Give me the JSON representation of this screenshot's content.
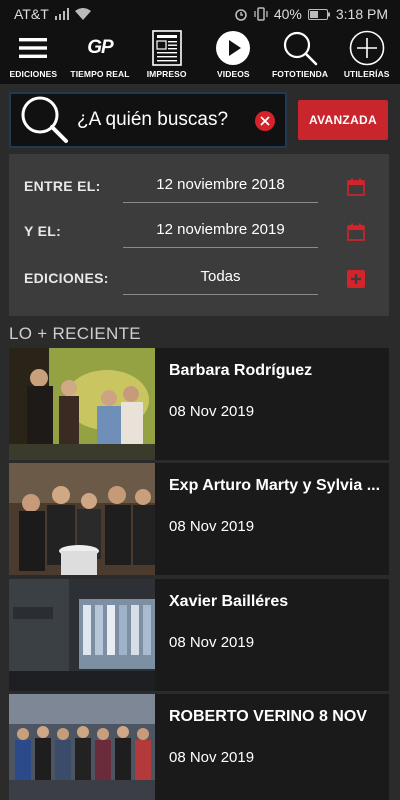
{
  "status": {
    "carrier": "AT&T",
    "battery": "40%",
    "time": "3:18 PM"
  },
  "nav": [
    {
      "label": "EDICIONES",
      "icon": "hamburger-menu-icon"
    },
    {
      "label": "TIEMPO REAL",
      "icon": "gp-logo-icon",
      "logo_text": "GP"
    },
    {
      "label": "IMPRESO",
      "icon": "newspaper-icon"
    },
    {
      "label": "VIDEOS",
      "icon": "play-icon"
    },
    {
      "label": "FOTOTIENDA",
      "icon": "search-icon"
    },
    {
      "label": "UTILERÍAS",
      "icon": "plus-circle-icon"
    }
  ],
  "search": {
    "placeholder": "¿A quién buscas?",
    "advanced_label": "AVANZADA"
  },
  "filter": {
    "from_label": "ENTRE EL:",
    "from_value": "12 noviembre 2018",
    "to_label": "Y EL:",
    "to_value": "12 noviembre 2019",
    "editions_label": "EDICIONES:",
    "editions_value": "Todas"
  },
  "section_title": "LO + RECIENTE",
  "items": [
    {
      "title": "Barbara Rodríguez",
      "date": "08 Nov 2019"
    },
    {
      "title": "Exp Arturo Marty y Sylvia ...",
      "date": "08 Nov 2019"
    },
    {
      "title": "Xavier Bailléres",
      "date": "08 Nov 2019"
    },
    {
      "title": "ROBERTO VERINO 8 NOV",
      "date": "08 Nov 2019"
    }
  ],
  "colors": {
    "accent": "#c8252d",
    "background": "#2b2b2b",
    "panel": "#3c3c3c",
    "card": "#1a1a1a"
  }
}
